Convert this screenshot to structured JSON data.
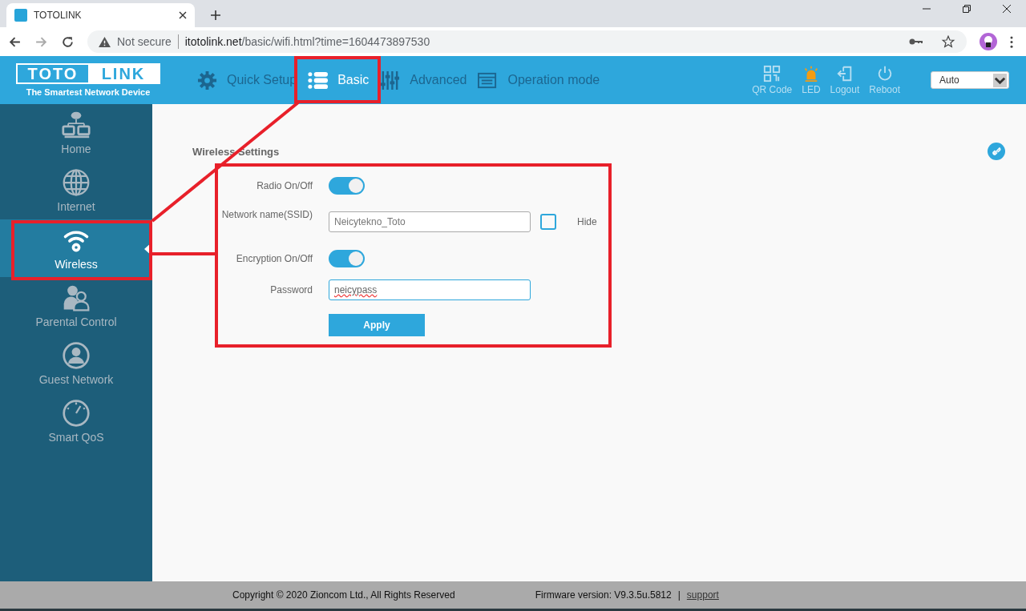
{
  "browser": {
    "tab_title": "TOTOLINK",
    "security": "Not secure",
    "url_host": "itotolink.net",
    "url_path": "/basic/wifi.html?time=1604473897530"
  },
  "header": {
    "logo_left": "TOTO",
    "logo_right": "LINK",
    "tagline": "The Smartest Network Device",
    "nav": [
      {
        "label": "Quick Setup",
        "kind": "gear",
        "selected": false
      },
      {
        "label": "Basic",
        "kind": "list",
        "selected": true
      },
      {
        "label": "Advanced",
        "kind": "sliders",
        "selected": false
      },
      {
        "label": "Operation mode",
        "kind": "window",
        "selected": false
      }
    ],
    "tools": [
      {
        "label": "QR Code",
        "kind": "qr"
      },
      {
        "label": "LED",
        "kind": "led"
      },
      {
        "label": "Logout",
        "kind": "logout"
      },
      {
        "label": "Reboot",
        "kind": "power"
      }
    ],
    "language": "Auto"
  },
  "sidebar": [
    {
      "label": "Home",
      "kind": "home",
      "selected": false
    },
    {
      "label": "Internet",
      "kind": "globe",
      "selected": false
    },
    {
      "label": "Wireless",
      "kind": "wifi",
      "selected": true
    },
    {
      "label": "Parental Control",
      "kind": "parental",
      "selected": false
    },
    {
      "label": "Guest Network",
      "kind": "guest",
      "selected": false
    },
    {
      "label": "Smart QoS",
      "kind": "gauge",
      "selected": false
    }
  ],
  "form": {
    "title": "Wireless Settings",
    "rows": [
      {
        "label": "Radio On/Off",
        "kind": "toggle",
        "on": true
      },
      {
        "label": "Network name(SSID)",
        "kind": "text",
        "value": "Neicytekno_Toto",
        "hide_label": "Hide",
        "checked": false
      },
      {
        "label": "Encryption On/Off",
        "kind": "toggle",
        "on": true
      },
      {
        "label": "Password",
        "kind": "password",
        "value": "neicypass"
      }
    ],
    "apply": "Apply"
  },
  "footer": {
    "copyright": "Copyright © 2020 Zioncom Ltd., All Rights Reserved",
    "firmware": "Firmware version: V9.3.5u.5812",
    "separator": "|",
    "support": "support"
  }
}
